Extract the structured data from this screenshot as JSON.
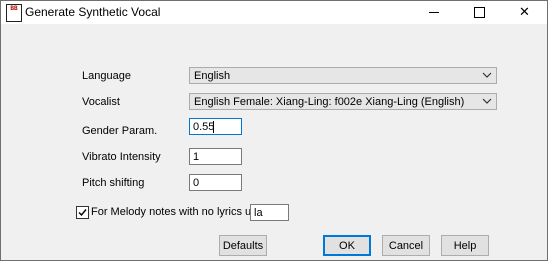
{
  "window": {
    "title": "Generate Synthetic Vocal",
    "icon": "app-icon",
    "icon_text": "BB"
  },
  "controls": {
    "minimize_icon": "minimize-icon",
    "maximize_icon": "maximize-icon",
    "close_glyph": "✕"
  },
  "form": {
    "language": {
      "label": "Language",
      "value": "English"
    },
    "vocalist": {
      "label": "Vocalist",
      "value": "English Female: Xiang-Ling:   f002e Xiang-Ling (English)"
    },
    "gender": {
      "label": "Gender Param.",
      "value": "0.55"
    },
    "vibrato": {
      "label": "Vibrato Intensity",
      "value": "1"
    },
    "pitch": {
      "label": "Pitch shifting",
      "value": "0"
    },
    "melody": {
      "label": "For Melody notes with no lyrics use:",
      "checked": true,
      "value": "la"
    }
  },
  "buttons": {
    "defaults": "Defaults",
    "ok": "OK",
    "cancel": "Cancel",
    "help": "Help"
  },
  "colors": {
    "focus": "#0078d7",
    "dialog_bg": "#f0f0f0"
  }
}
